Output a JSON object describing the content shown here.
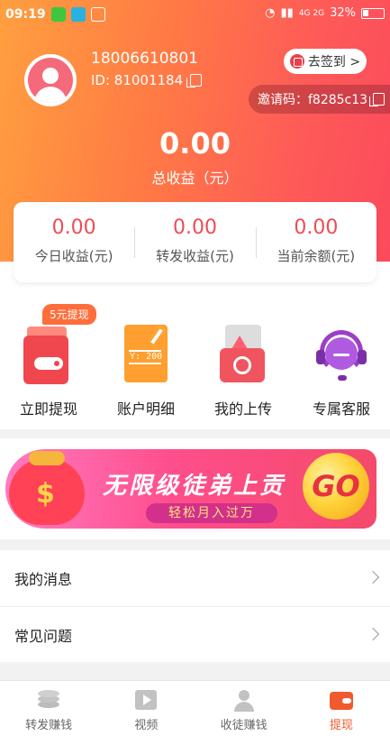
{
  "status_bar": {
    "time": "09:19",
    "network": "4G 2G",
    "battery": "32%"
  },
  "profile": {
    "phone": "18006610801",
    "id_label": "ID: 81001184"
  },
  "signin_button": "去签到 >",
  "invite": {
    "text": "邀请码：f8285c13"
  },
  "earnings": {
    "total": "0.00",
    "total_label": "总收益（元）"
  },
  "stats": [
    {
      "value": "0.00",
      "label": "今日收益(元)"
    },
    {
      "value": "0.00",
      "label": "转发收益(元)"
    },
    {
      "value": "0.00",
      "label": "当前余额(元)"
    }
  ],
  "quick_menu": {
    "badge": "5元提现",
    "items": [
      {
        "label": "立即提现",
        "icon": "wallet-icon"
      },
      {
        "label": "账户明细",
        "icon": "ledger-icon"
      },
      {
        "label": "我的上传",
        "icon": "upload-photo-icon"
      },
      {
        "label": "专属客服",
        "icon": "customer-service-icon"
      }
    ],
    "ledger_text": "Y: 200"
  },
  "banner": {
    "title": "无限级徒弟上贡",
    "subtitle": "轻松月入过万",
    "go": "GO",
    "dollar": "$"
  },
  "list": [
    {
      "label": "我的消息"
    },
    {
      "label": "常见问题"
    }
  ],
  "tabs": [
    {
      "label": "转发赚钱",
      "icon": "coins-icon",
      "active": false
    },
    {
      "label": "视频",
      "icon": "video-icon",
      "active": false
    },
    {
      "label": "收徒赚钱",
      "icon": "user-icon",
      "active": false
    },
    {
      "label": "提现",
      "icon": "wallet-icon",
      "active": true
    }
  ],
  "colors": {
    "accent": "#f05a2e",
    "stat_value": "#f04c55",
    "gradient_start": "#ff9f3f",
    "gradient_end": "#fb4a5c"
  }
}
